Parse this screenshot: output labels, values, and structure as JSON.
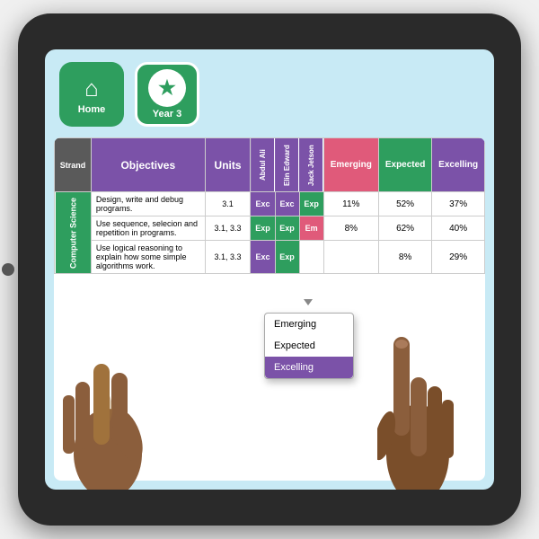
{
  "nav": {
    "home_label": "Home",
    "year3_label": "Year 3",
    "home_icon": "⌂",
    "star_icon": "★"
  },
  "table": {
    "headers": {
      "strand": "Strand",
      "objectives": "Objectives",
      "units": "Units",
      "students": [
        "Abdul Ali",
        "Elin Edward",
        "Jack Jetson"
      ],
      "emerging": "Emerging",
      "expected": "Expected",
      "excelling": "Excelling"
    },
    "strand": "Computer Science",
    "rows": [
      {
        "objective": "Design, write and debug programs.",
        "units": "3.1",
        "student_vals": [
          "Exc",
          "Exc",
          "Exp"
        ],
        "emerging": "11%",
        "expected": "52%",
        "excelling": "37%"
      },
      {
        "objective": "Use sequence, selecion and repetition in programs.",
        "units": "3.1, 3.3",
        "student_vals": [
          "Exp",
          "Exp",
          "Em"
        ],
        "emerging": "8%",
        "expected": "62%",
        "excelling": "40%"
      },
      {
        "objective": "Use logical reasoning to explain how some simple algorithms work.",
        "units": "3.1, 3.3",
        "student_vals": [
          "Exc",
          "Exp",
          ""
        ],
        "emerging": "",
        "expected": "8%",
        "excelling": "29%"
      }
    ]
  },
  "dropdown": {
    "items": [
      "Emerging",
      "Expected",
      "Excelling"
    ]
  }
}
